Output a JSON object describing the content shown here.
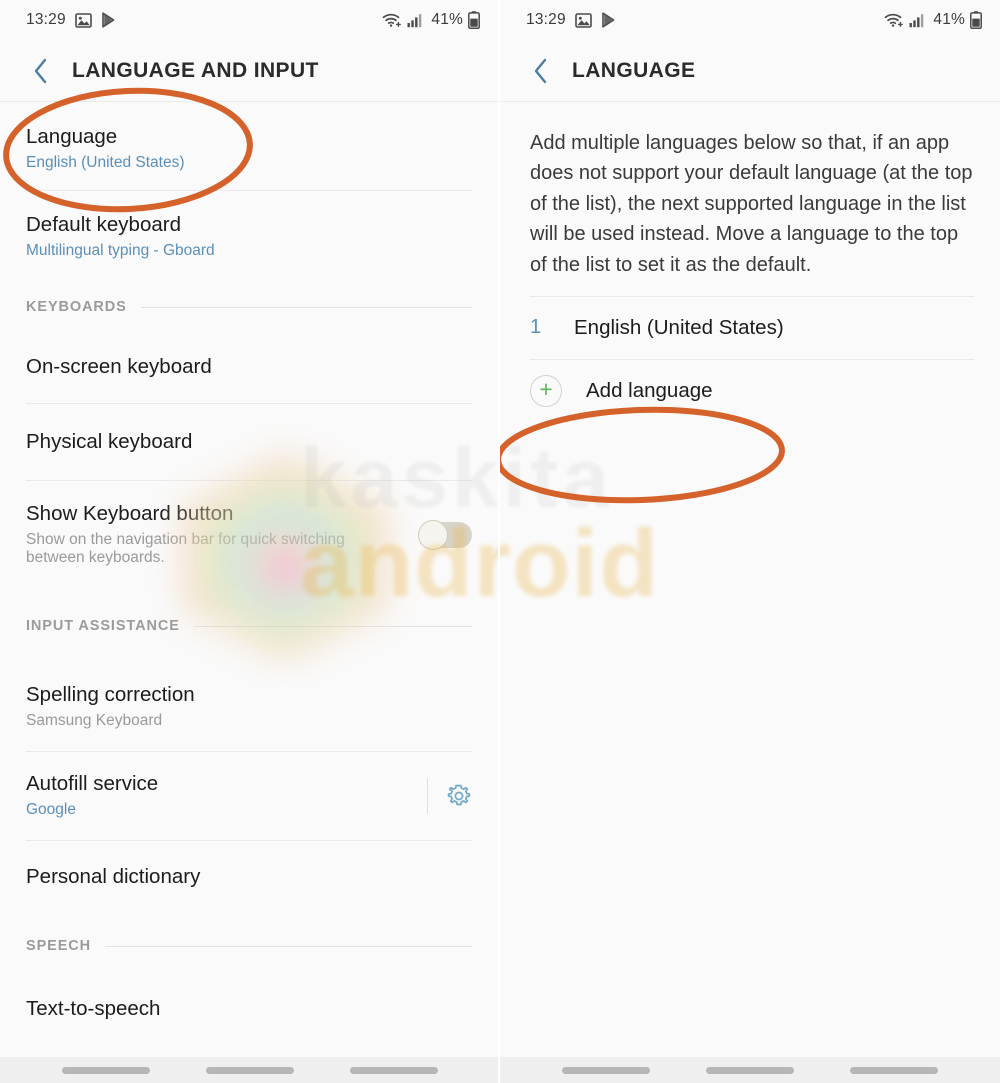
{
  "status_bar": {
    "time": "13:29",
    "battery_percent": "41%",
    "icons": [
      "gallery-icon",
      "play-store-icon",
      "wifi-icon",
      "cellular-signal-icon",
      "battery-icon"
    ]
  },
  "colors": {
    "accent_blue": "#5b8fb9",
    "annotation_orange": "#d4622a",
    "plus_green": "#5fb65f",
    "title_dark": "#2b2b2b",
    "background": "#fafafa"
  },
  "left_panel": {
    "title": "LANGUAGE AND INPUT",
    "back_label": "Back",
    "rows": [
      {
        "title": "Language",
        "sub": "English (United States)",
        "sub_style": "blue"
      },
      {
        "title": "Default keyboard",
        "sub": "Multilingual typing - Gboard",
        "sub_style": "blue"
      }
    ],
    "section_keyboards": "KEYBOARDS",
    "keyboard_rows": [
      {
        "title": "On-screen keyboard"
      },
      {
        "title": "Physical keyboard"
      }
    ],
    "show_keyboard_button": {
      "title": "Show Keyboard button",
      "sub": "Show on the navigation bar for quick switching between keyboards.",
      "toggle_state": "off"
    },
    "section_input_assistance": "INPUT ASSISTANCE",
    "input_rows": [
      {
        "title": "Spelling correction",
        "sub": "Samsung Keyboard",
        "sub_style": "grey"
      },
      {
        "title": "Autofill service",
        "sub": "Google",
        "sub_style": "blue",
        "has_gear": true
      },
      {
        "title": "Personal dictionary",
        "sub": "",
        "sub_style": "none"
      }
    ],
    "section_speech": "SPEECH",
    "speech_rows": [
      {
        "title": "Text-to-speech"
      }
    ]
  },
  "right_panel": {
    "title": "LANGUAGE",
    "back_label": "Back",
    "description": "Add multiple languages below so that, if an app does not support your default language (at the top of the list), the next supported language in the list will be used instead. Move a language to the top of the list to set it as the default.",
    "languages": [
      {
        "index": "1",
        "name": "English (United States)"
      }
    ],
    "add_language_label": "Add language"
  },
  "watermark": {
    "line1": "kaskita",
    "line2": "android"
  },
  "annotations": [
    {
      "target": "language-row",
      "shape": "ellipse"
    },
    {
      "target": "add-language-row",
      "shape": "ellipse"
    }
  ]
}
